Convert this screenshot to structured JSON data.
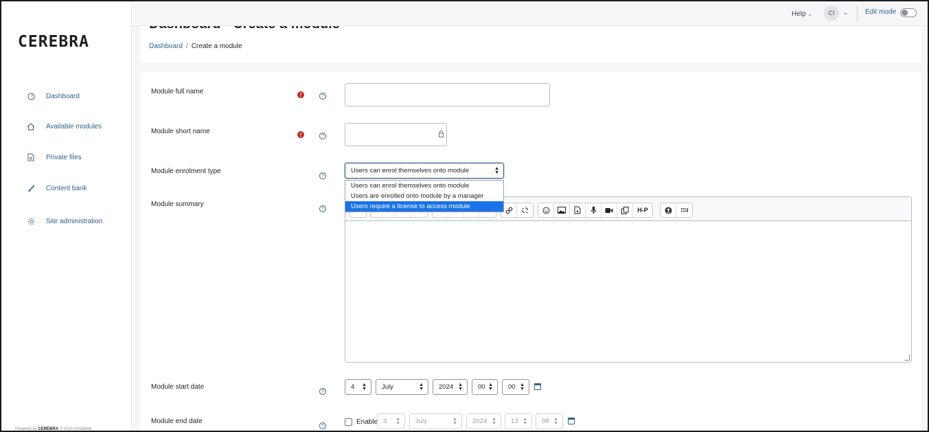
{
  "brand": {
    "logo": "CEREBRA"
  },
  "sidebar": {
    "items": [
      {
        "label": "Dashboard",
        "icon": "gauge-icon"
      },
      {
        "label": "Available modules",
        "icon": "home-icon"
      },
      {
        "label": "Private files",
        "icon": "file-icon"
      },
      {
        "label": "Content bank",
        "icon": "brush-icon"
      },
      {
        "label": "Site administration",
        "icon": "gear-icon"
      }
    ],
    "footer_prefix": "Powered by",
    "footer_brand": "CEREBRA",
    "footer_suffix": "© 2024 InfraWeld"
  },
  "topbar": {
    "help": "Help",
    "user_initials": "CI",
    "edit_mode": "Edit mode"
  },
  "header": {
    "title": "Dashboard - Create a module",
    "breadcrumb": {
      "home": "Dashboard",
      "separator": "/",
      "current": "Create a module"
    }
  },
  "form": {
    "full_name": {
      "label": "Module full name",
      "value": ""
    },
    "short_name": {
      "label": "Module short name",
      "value": ""
    },
    "enrolment_type": {
      "label": "Module enrolment type",
      "selected": "Users can enrol themselves onto module",
      "options": [
        "Users can enrol themselves onto module",
        "Users are enrolled onto module by a manager",
        "Users require a license to access module"
      ],
      "highlighted_option": "Users require a license to access module"
    },
    "summary": {
      "label": "Module summary",
      "toolbar_h5p": "H-P"
    },
    "start_date": {
      "label": "Module start date",
      "day": "4",
      "month": "July",
      "year": "2024",
      "hour": "00",
      "minute": "00"
    },
    "end_date": {
      "label": "Module end date",
      "enable_label": "Enable",
      "enabled": false,
      "day": "3",
      "month": "July",
      "year": "2024",
      "hour": "13",
      "minute": "08"
    }
  },
  "colors": {
    "link": "#2e5f8a",
    "required": "#c62828",
    "highlight": "#1a73e8"
  }
}
